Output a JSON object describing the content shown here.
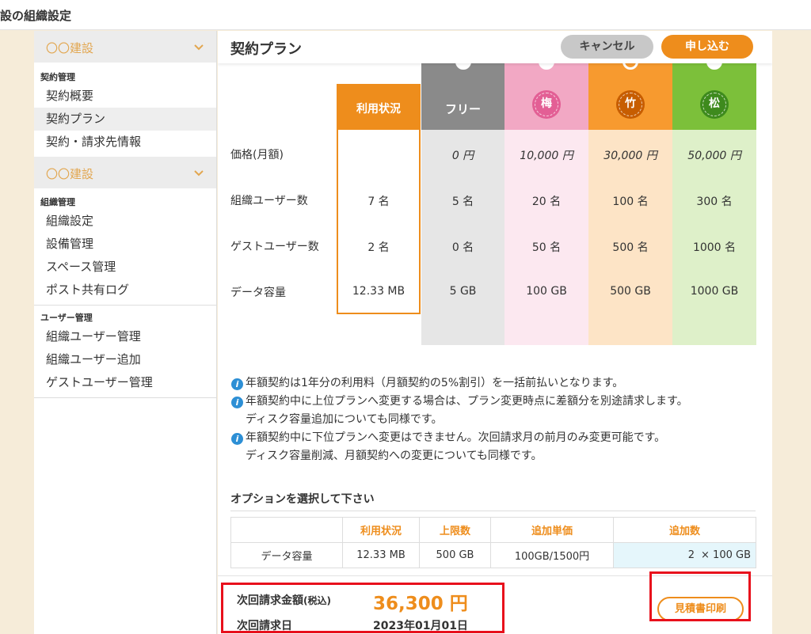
{
  "app": {
    "title": "設の組織設定"
  },
  "colors": {
    "accent": "#ee8d1c",
    "free": "#8a8a8a",
    "ume": "#f2a8c4",
    "take": "#f79a2f",
    "matsu": "#7cc03a",
    "highlight": "#e8101c",
    "info": "#2d8fd5"
  },
  "sidebar": {
    "group1": {
      "name": "〇〇建設",
      "icon": "chevron-down-icon"
    },
    "section1": {
      "label": "契約管理",
      "items": [
        {
          "label": "契約概要"
        },
        {
          "label": "契約プラン",
          "active": true
        },
        {
          "label": "契約・請求先情報"
        }
      ]
    },
    "group2": {
      "name": "〇〇建設",
      "icon": "chevron-down-icon"
    },
    "section2": {
      "label": "組織管理",
      "items": [
        {
          "label": "組織設定"
        },
        {
          "label": "設備管理"
        },
        {
          "label": "スペース管理"
        },
        {
          "label": "ポスト共有ログ"
        }
      ]
    },
    "section3": {
      "label": "ユーザー管理",
      "items": [
        {
          "label": "組織ユーザー管理"
        },
        {
          "label": "組織ユーザー追加"
        },
        {
          "label": "ゲストユーザー管理"
        }
      ]
    }
  },
  "main": {
    "title": "契約プラン",
    "cancel_label": "キャンセル",
    "apply_label": "申し込む"
  },
  "plans": {
    "row_labels": [
      "価格(月額)",
      "組織ユーザー数",
      "ゲストユーザー数",
      "データ容量"
    ],
    "usage": {
      "header": "利用状況",
      "values": [
        "",
        "7 名",
        "2 名",
        "12.33 MB"
      ]
    },
    "columns": [
      {
        "name": "フリー",
        "values": [
          "0 円",
          "5 名",
          "0 名",
          "5 GB"
        ]
      },
      {
        "name": "梅",
        "values": [
          "10,000 円",
          "20 名",
          "50 名",
          "100 GB"
        ]
      },
      {
        "name": "竹",
        "values": [
          "30,000 円",
          "100 名",
          "500 名",
          "500 GB"
        ]
      },
      {
        "name": "松",
        "values": [
          "50,000 円",
          "300 名",
          "1000 名",
          "1000 GB"
        ]
      }
    ]
  },
  "notes": [
    {
      "text": "年額契約は1年分の利用料（月額契約の5%割引）を一括前払いとなります。",
      "icon": true
    },
    {
      "text": "年額契約中に上位プランへ変更する場合は、プラン変更時点に差額分を別途請求します。",
      "icon": true
    },
    {
      "text": "ディスク容量追加についても同様です。",
      "icon": false
    },
    {
      "text": "年額契約中に下位プランへ変更はできません。次回請求月の前月のみ変更可能です。",
      "icon": true
    },
    {
      "text": "ディスク容量削減、月額契約への変更についても同様です。",
      "icon": false
    }
  ],
  "info_icon_glyph": "i",
  "options": {
    "title": "オプションを選択して下さい",
    "headers": [
      "",
      "利用状況",
      "上限数",
      "追加単価",
      "追加数"
    ],
    "row": {
      "name": "データ容量",
      "usage": "12.33 MB",
      "limit": "500 GB",
      "unit_price": "100GB/1500円",
      "qty": "2",
      "qty_unit": "× 100 GB"
    }
  },
  "summary": {
    "amount_label": "次回請求金額",
    "tax_label": "(税込)",
    "amount": "36,300 円",
    "date_label": "次回請求日",
    "date": "2023年01月01日",
    "estimate_label": "見積書印刷"
  }
}
